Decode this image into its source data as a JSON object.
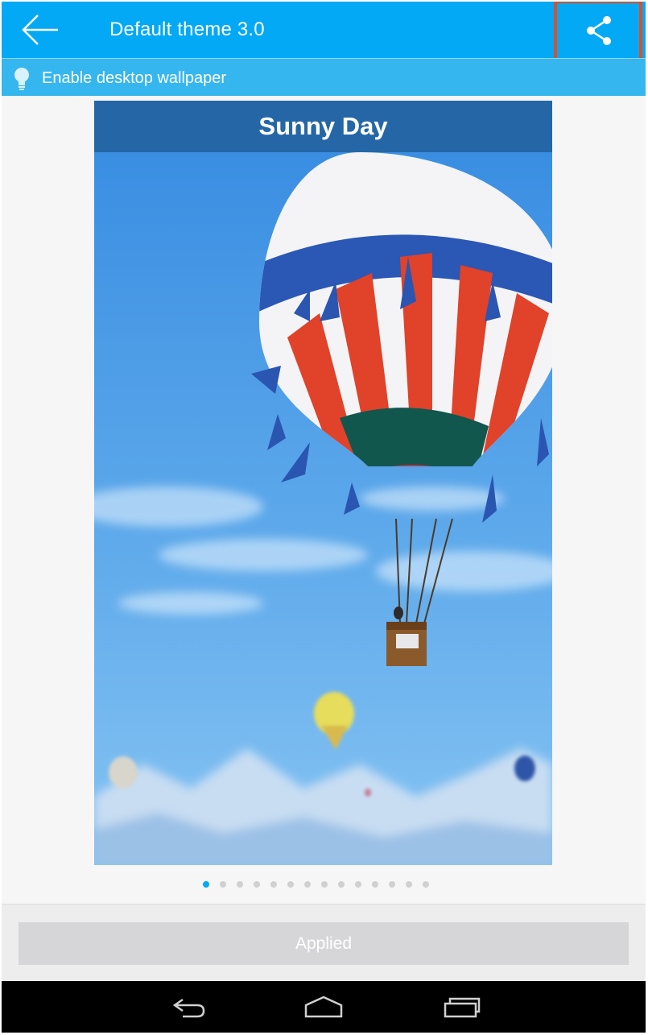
{
  "appbar": {
    "title": "Default theme 3.0",
    "background": "#03a9f4",
    "highlight_color": "#d9502b"
  },
  "icons": {
    "back": "arrow-left-icon",
    "share": "share-icon",
    "bulb": "lightbulb-icon"
  },
  "hint": {
    "label": "Enable desktop wallpaper"
  },
  "preview": {
    "title": "Sunny Day",
    "header_color": "#2567a6"
  },
  "pager": {
    "total": 14,
    "active_index": 0,
    "active_color": "#03a9f4"
  },
  "action": {
    "label": "Applied",
    "state": "disabled"
  },
  "navigation": {
    "back": "nav-back-icon",
    "home": "nav-home-icon",
    "recents": "nav-recents-icon"
  }
}
